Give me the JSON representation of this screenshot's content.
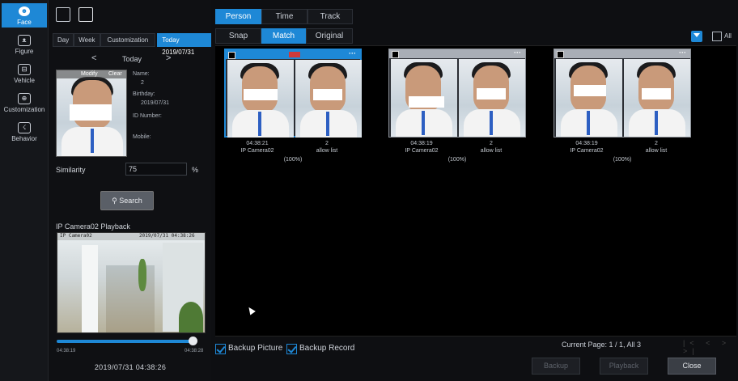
{
  "nav": {
    "items": [
      {
        "label": "Face",
        "icon": "face-icon",
        "active": true
      },
      {
        "label": "Figure",
        "icon": "figure-icon"
      },
      {
        "label": "Vehicle",
        "icon": "vehicle-icon"
      },
      {
        "label": "Customization",
        "icon": "customization-icon"
      },
      {
        "label": "Behavior",
        "icon": "behavior-icon"
      }
    ]
  },
  "left": {
    "period_tabs": [
      "Day",
      "Week",
      "Customization",
      "Today 2019/07/31"
    ],
    "date_prev": "<",
    "date_label": "Today",
    "date_next": ">",
    "modify": "Modify",
    "clear": "Clear",
    "info": {
      "name_label": "Name:",
      "name_value": "2",
      "birthday_label": "Birthday:",
      "birthday_value": "2019/07/31",
      "id_label": "ID Number:",
      "mobile_label": "Mobile:"
    },
    "similarity_label": "Similarity",
    "similarity_value": "75",
    "similarity_unit": "%",
    "search_label": "Search",
    "playback_title": "IP Camera02 Playback",
    "osd_camera": "IP Camera02",
    "osd_datetime": "2019/07/31 04:38:26",
    "time_start": "04:38:19",
    "time_end": "04:38:28",
    "current_time": "2019/07/31 04:38:26"
  },
  "tabs_top": [
    "Person",
    "Time",
    "Track"
  ],
  "tabs_sub": [
    "Snap",
    "Match",
    "Original"
  ],
  "all_label": "All",
  "results": [
    {
      "time": "04:38:21",
      "camera": "IP Camera02",
      "name": "2",
      "list": "allow list",
      "pct": "(100%)"
    },
    {
      "time": "04:38:19",
      "camera": "IP Camera02",
      "name": "2",
      "list": "allow list",
      "pct": "(100%)"
    },
    {
      "time": "04:38:19",
      "camera": "IP Camera02",
      "name": "2",
      "list": "allow list",
      "pct": "(100%)"
    }
  ],
  "bottom": {
    "backup_picture": "Backup Picture",
    "backup_record": "Backup Record",
    "page_info": "Current Page: 1 / 1, All 3",
    "pager": "|< < > >|",
    "backup_btn": "Backup",
    "playback_btn": "Playback",
    "close_btn": "Close"
  },
  "colors": {
    "accent": "#1e88d6",
    "background": "#0e0f12"
  }
}
